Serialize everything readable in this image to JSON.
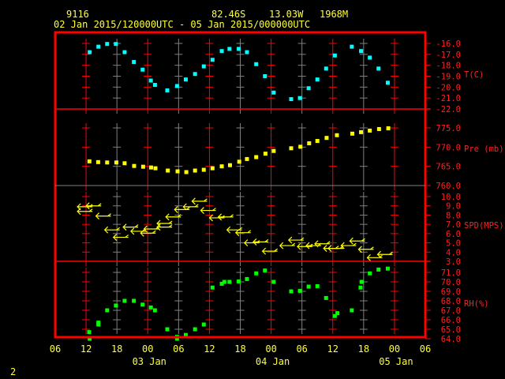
{
  "header": {
    "station": "9116",
    "lat": "82.46S",
    "lon": "13.03W",
    "elev": "1968M",
    "period": "02 Jan 2015/120000UTC - 05 Jan 2015/000000UTC"
  },
  "footer": {
    "page": "2"
  },
  "colors": {
    "frame": "#ff0000",
    "temp": "#00ffff",
    "pres": "#ffff00",
    "wind": "#ffff00",
    "rh": "#00ff00",
    "grid_alt": "#808080"
  },
  "chart_data": {
    "type": "scatter",
    "title": "Meteogram 9116",
    "x_unit": "hours since 02 Jan 06UTC",
    "xlim": [
      0,
      72
    ],
    "x_ticks": [
      "06",
      "12",
      "18",
      "00",
      "06",
      "12",
      "18",
      "00",
      "06",
      "12",
      "18",
      "00",
      "06"
    ],
    "day_labels": [
      {
        "label": "03 Jan",
        "hour": 24
      },
      {
        "label": "04 Jan",
        "hour": 48
      },
      {
        "label": "05 Jan",
        "hour": 72
      }
    ],
    "panels": [
      {
        "name": "T(C)",
        "ylim": [
          -22,
          -16
        ],
        "ticks": [
          "-16.0",
          "-17.0",
          "-18.0",
          "-19.0",
          "-20.0",
          "-21.0",
          "-22.0"
        ],
        "x": [
          6.7,
          8.4,
          10.1,
          11.8,
          13.5,
          15.3,
          17.0,
          18.6,
          19.4,
          21.8,
          23.7,
          25.4,
          27.2,
          28.9,
          30.6,
          32.4,
          33.9,
          35.7,
          37.3,
          39.1,
          40.8,
          42.5,
          45.9,
          47.6,
          49.3,
          51.0,
          52.7,
          54.4,
          57.7,
          59.5,
          61.2,
          62.9,
          64.7
        ],
        "y": [
          -16.8,
          -16.3,
          -16.05,
          -16.05,
          -16.8,
          -17.7,
          -18.4,
          -19.4,
          -19.8,
          -20.3,
          -19.9,
          -19.3,
          -18.8,
          -18.1,
          -17.5,
          -16.7,
          -16.5,
          -16.5,
          -16.8,
          -17.9,
          -19.0,
          -20.5,
          -21.1,
          -21.0,
          -20.1,
          -19.3,
          -18.3,
          -17.1,
          -16.3,
          -16.7,
          -17.3,
          -18.3,
          -19.6
        ]
      },
      {
        "name": "Pre (mb)",
        "ylim": [
          760,
          775
        ],
        "ticks": [
          "775.0",
          "770.0",
          "765.0",
          "760.0"
        ],
        "x": [
          6.65,
          8.35,
          10.1,
          11.9,
          13.5,
          15.35,
          17.1,
          18.65,
          19.5,
          21.9,
          23.8,
          25.5,
          27.2,
          28.9,
          30.6,
          32.4,
          34.0,
          35.8,
          37.3,
          39.1,
          40.9,
          42.5,
          45.9,
          47.7,
          49.4,
          51.0,
          52.8,
          54.8,
          57.8,
          59.5,
          61.2,
          63.0,
          64.8
        ],
        "y": [
          766.3,
          766.1,
          766.0,
          766.0,
          765.8,
          765.1,
          764.9,
          764.7,
          764.5,
          763.9,
          763.7,
          763.5,
          763.9,
          764.1,
          764.5,
          765.0,
          765.3,
          766.2,
          766.9,
          767.4,
          768.3,
          769.0,
          769.7,
          770.1,
          771.0,
          771.6,
          772.4,
          773.1,
          773.5,
          773.9,
          774.3,
          774.7,
          774.9
        ]
      },
      {
        "name": "SPD(MPS)",
        "ylim": [
          3,
          10
        ],
        "ticks": [
          "10.0",
          "9.0",
          "8.0",
          "7.0",
          "6.0",
          "5.0",
          "4.0",
          "3.0"
        ],
        "x": [
          5.7,
          5.7,
          7.4,
          9.3,
          11.0,
          12.7,
          14.6,
          16.1,
          18.0,
          18.65,
          21.2,
          21.2,
          22.9,
          24.6,
          26.3,
          28.0,
          29.7,
          31.4,
          33.1,
          34.8,
          36.5,
          38.2,
          39.9,
          41.7,
          45.1,
          46.8,
          48.5,
          50.2,
          51.9,
          53.6,
          54.5,
          57.0,
          58.7,
          60.4,
          62.1,
          64.1
        ],
        "y": [
          8.9,
          8.4,
          9.0,
          7.9,
          6.4,
          5.6,
          6.7,
          6.25,
          6.05,
          6.5,
          7.1,
          6.7,
          7.8,
          8.6,
          8.9,
          9.5,
          8.5,
          7.7,
          7.8,
          6.4,
          6.1,
          5.0,
          5.1,
          4.1,
          4.7,
          5.3,
          4.6,
          4.7,
          4.9,
          4.4,
          4.4,
          4.7,
          5.2,
          4.3,
          3.4,
          3.75
        ]
      },
      {
        "name": "RH(%)",
        "ylim": [
          64,
          71
        ],
        "ticks": [
          "71.0",
          "70.0",
          "69.0",
          "68.0",
          "67.0",
          "66.0",
          "65.0",
          "64.0"
        ],
        "x": [
          6.6,
          6.7,
          8.4,
          8.4,
          10.1,
          11.8,
          13.5,
          15.3,
          17.0,
          18.6,
          19.4,
          21.8,
          23.7,
          23.7,
          25.4,
          27.2,
          28.9,
          30.6,
          32.4,
          32.9,
          33.9,
          35.7,
          37.3,
          39.1,
          40.8,
          42.5,
          45.9,
          47.6,
          49.3,
          51.0,
          52.7,
          54.4,
          54.9,
          57.7,
          59.4,
          59.6,
          61.2,
          62.9,
          64.7
        ],
        "y": [
          64.7,
          64.0,
          65.7,
          65.5,
          67.0,
          67.5,
          68.0,
          68.0,
          67.6,
          67.3,
          67.0,
          65.0,
          64.0,
          64.2,
          64.4,
          65.0,
          65.5,
          69.4,
          69.8,
          70.0,
          70.0,
          70.05,
          70.3,
          70.9,
          71.2,
          70.0,
          69.0,
          69.05,
          69.5,
          69.55,
          68.3,
          66.4,
          66.7,
          67.0,
          69.4,
          70.0,
          70.9,
          71.3,
          71.4
        ]
      }
    ]
  }
}
